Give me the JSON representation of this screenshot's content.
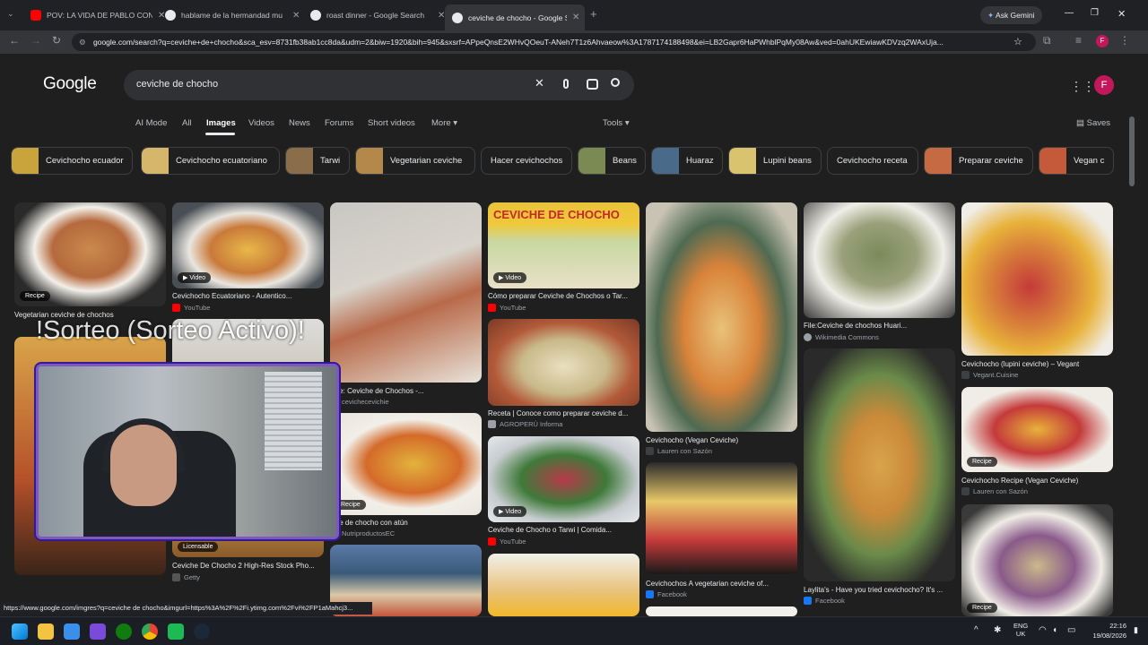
{
  "tabs": [
    {
      "label": "POV: LA VIDA DE PABLO CON PI",
      "color": "#ff0000"
    },
    {
      "label": "hablame de la hermandad mu",
      "color": "#9aa0a6"
    },
    {
      "label": "roast dinner - Google Search",
      "color": "#9aa0a6"
    },
    {
      "label": "ceviche de chocho - Google Se",
      "color": "#9aa0a6"
    }
  ],
  "ask_gemini": "Ask Gemini",
  "url": "google.com/search?q=ceviche+de+chocho&sca_esv=8731fb38ab1cc8da&udm=2&biw=1920&bih=945&sxsrf=APpeQnsE2WHvQOeuT-ANeh7T1z6Ahvaeow%3A1787174188498&ei=LB2Gapr6HaPWhblPqMy08Aw&ved=0ahUKEwiawKDVzq2WAxUja...",
  "logo": "Google",
  "search": {
    "query": "ceviche de chocho"
  },
  "avatar_letter": "F",
  "nav": {
    "ai_mode": "AI Mode",
    "all": "All",
    "images": "Images",
    "videos": "Videos",
    "news": "News",
    "forums": "Forums",
    "short_videos": "Short videos",
    "more": "More ▾",
    "tools": "Tools ▾",
    "saves": "Saves"
  },
  "chips": [
    {
      "label": "Cevichocho ecuador",
      "color": "#c9a43c"
    },
    {
      "label": "Cevichocho ecuatoriano",
      "color": "#d6b66a"
    },
    {
      "label": "Tarwi",
      "color": "#8a6e4b"
    },
    {
      "label": "Vegetarian ceviche",
      "color": "#b4884a"
    },
    {
      "label": "Hacer cevichochos",
      "color": ""
    },
    {
      "label": "Beans",
      "color": "#7a8a52"
    },
    {
      "label": "Huaraz",
      "color": "#4a6a8a"
    },
    {
      "label": "Lupini beans",
      "color": "#d9c36e"
    },
    {
      "label": "Cevichocho receta",
      "color": ""
    },
    {
      "label": "Preparar ceviche",
      "color": "#c56a42"
    },
    {
      "label": "Vegan c",
      "color": "#c45a3a"
    }
  ],
  "results": {
    "r1": {
      "caption": "Vegetarian ceviche de chochos",
      "badge": "Recipe"
    },
    "r2": {
      "caption": "Cevichocho Ecuatoriano - Autentico...",
      "source": "YouTube",
      "badge": "Video"
    },
    "r3": {
      "caption": "cipe: Ceviche de Chochos -...",
      "source": "cevichecevichie"
    },
    "r4": {
      "caption": "iche de chocho con atún",
      "source": "NutriproductosEC",
      "badge": "Recipe"
    },
    "r5": {
      "caption": "Cómo preparar Ceviche de Chochos o Tar...",
      "source": "YouTube",
      "badge": "Video",
      "banner": "CEVICHE DE CHOCHO"
    },
    "r6": {
      "caption": "Receta | Conoce como preparar ceviche d...",
      "source": "AGROPERÚ Informa"
    },
    "r7": {
      "caption": "Ceviche de Chocho o Tarwi | Comida...",
      "source": "YouTube",
      "badge": "Video"
    },
    "r8": {
      "caption": "Cevichocho (Vegan Ceviche)",
      "source": "Lauren con Sazón"
    },
    "r9": {
      "caption": "Cevichochos A vegetarian ceviche of...",
      "source": "Facebook"
    },
    "r10": {
      "caption": "File:Ceviche de chochos Huari...",
      "source": "Wikimedia Commons"
    },
    "r11": {
      "caption": "Laylita's - Have you tried cevichocho? It's ...",
      "source": "Facebook"
    },
    "r12": {
      "caption": "Cevichocho (lupini ceviche) – Vegant",
      "source": "Vegant.Cuisine"
    },
    "r13": {
      "caption": "Cevichocho Recipe (Vegan Ceviche)",
      "source": "Lauren con Sazón",
      "badge": "Recipe"
    },
    "r14": {
      "badge": "Recipe"
    },
    "r15": {
      "caption": "Ceviche De Chocho 2 High-Res Stock Pho...",
      "source": "Getty",
      "badge": "Licensable"
    }
  },
  "overlay_text": "!Sorteo (Sorteo Activo)!",
  "status_url": "https://www.google.com/imgres?q=ceviche de chocho&imgurl=https%3A%2F%2Fi.ytimg.com%2Fvi%2FP1aMahcj3...",
  "taskbar": {
    "lang": "ENG",
    "region": "UK",
    "time": "22:16",
    "date": "19/08/2026"
  }
}
